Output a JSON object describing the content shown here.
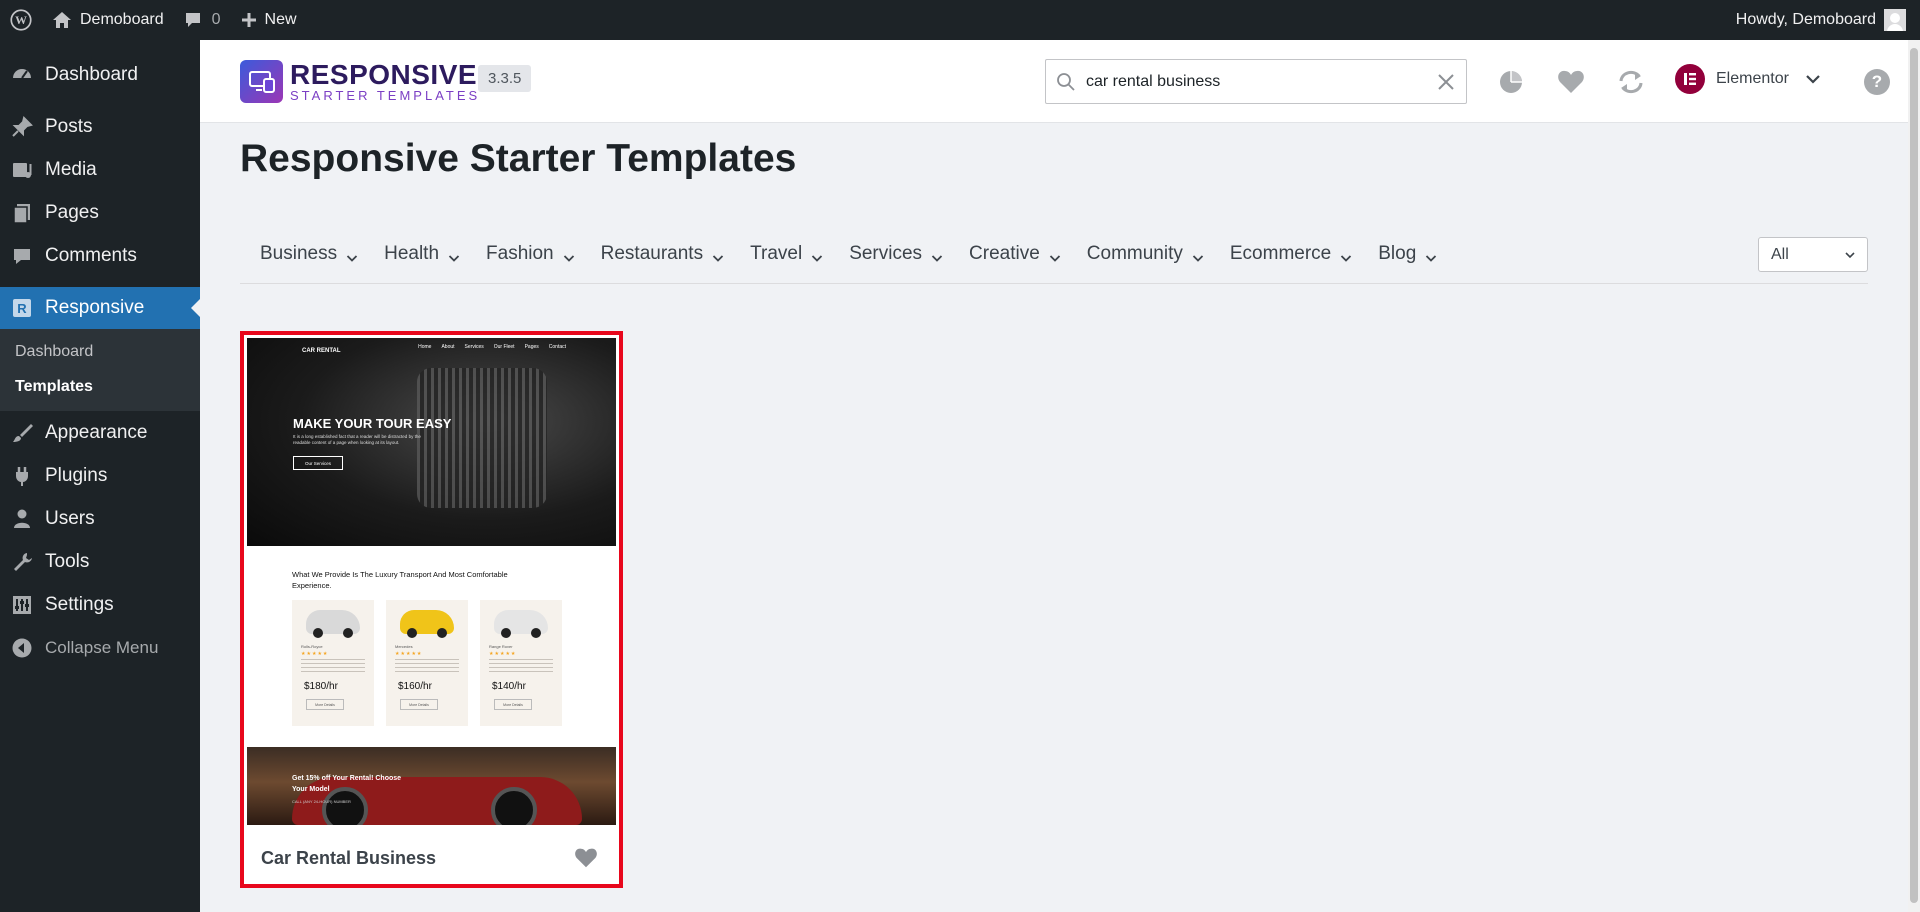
{
  "adminbar": {
    "site_name": "Demoboard",
    "comments_count": "0",
    "new_label": "New",
    "howdy": "Howdy, Demoboard"
  },
  "sidebar": {
    "items": [
      {
        "label": "Dashboard",
        "icon": "dashboard-icon"
      },
      {
        "label": "Posts",
        "icon": "pin-icon"
      },
      {
        "label": "Media",
        "icon": "media-icon"
      },
      {
        "label": "Pages",
        "icon": "pages-icon"
      },
      {
        "label": "Comments",
        "icon": "comment-icon"
      },
      {
        "label": "Responsive",
        "icon": "responsive-icon",
        "active": true
      },
      {
        "label": "Appearance",
        "icon": "brush-icon"
      },
      {
        "label": "Plugins",
        "icon": "plugin-icon"
      },
      {
        "label": "Users",
        "icon": "user-icon"
      },
      {
        "label": "Tools",
        "icon": "wrench-icon"
      },
      {
        "label": "Settings",
        "icon": "settings-icon"
      },
      {
        "label": "Collapse Menu",
        "icon": "collapse-icon"
      }
    ],
    "submenu": [
      {
        "label": "Dashboard"
      },
      {
        "label": "Templates",
        "current": true
      }
    ]
  },
  "header": {
    "brand_title": "RESPONSIVE",
    "brand_subtitle": "STARTER TEMPLATES",
    "version": "3.3.5",
    "search_value": "car rental business",
    "builder_label": "Elementor",
    "help_label": "?"
  },
  "main": {
    "page_title": "Responsive Starter Templates",
    "categories": [
      {
        "label": "Business"
      },
      {
        "label": "Health"
      },
      {
        "label": "Fashion"
      },
      {
        "label": "Restaurants"
      },
      {
        "label": "Travel"
      },
      {
        "label": "Services"
      },
      {
        "label": "Creative"
      },
      {
        "label": "Community"
      },
      {
        "label": "Ecommerce"
      },
      {
        "label": "Blog"
      }
    ],
    "type_filter": "All"
  },
  "template_card": {
    "title": "Car Rental Business",
    "highlight_color": "#e8071c",
    "preview": {
      "logo": "CAR RENTAL",
      "nav": [
        "Home",
        "About",
        "Services",
        "Our Fleet",
        "Pages",
        "Contact"
      ],
      "headline": "MAKE YOUR TOUR EASY",
      "body": "It is a long established fact that a reader will be distracted by the readable content of a page when looking at its layout.",
      "button": "Our Services",
      "intro": "What We Provide Is The Luxury Transport And Most Comfortable Experience.",
      "cars": [
        {
          "name": "Rolls-Royce",
          "price": "$180/hr",
          "color": "#d9d9d9"
        },
        {
          "name": "Mercedes",
          "price": "$160/hr",
          "color": "#f0c419"
        },
        {
          "name": "Range Rover",
          "price": "$140/hr",
          "color": "#e5e5e5"
        }
      ],
      "car_stars": "★★★★★",
      "more_label": "More Details",
      "promo": "Get 15% off Your Rental! Choose Your Model",
      "promo_small": "CALL (ANY 24-HOUR) NUMBER"
    }
  },
  "colors": {
    "admin_bg": "#1d2327",
    "accent": "#2271b1",
    "elementor": "#92003b"
  }
}
